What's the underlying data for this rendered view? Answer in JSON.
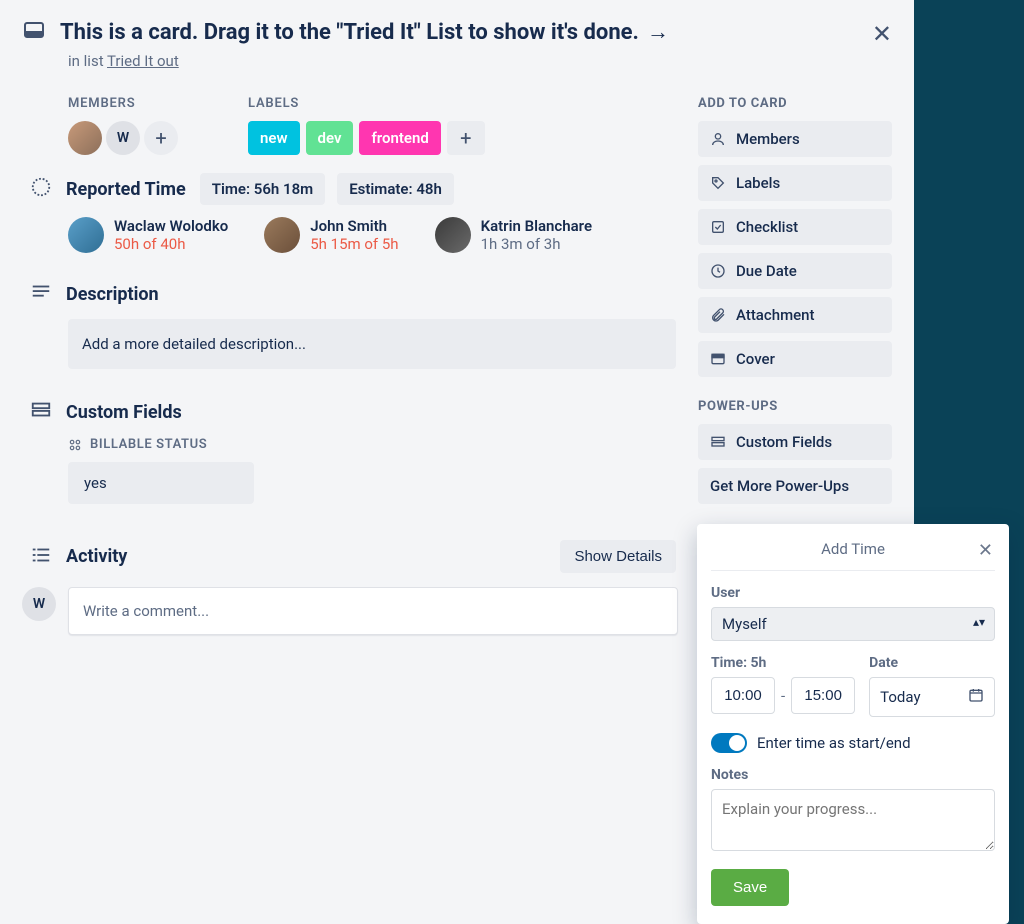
{
  "header": {
    "title": "This is a card. Drag it to the \"Tried It\" List to show it's done.",
    "in_list_prefix": "in list ",
    "in_list_link": "Tried It out"
  },
  "members": {
    "label": "MEMBERS",
    "initial": "W"
  },
  "labels": {
    "label": "LABELS",
    "items": [
      "new",
      "dev",
      "frontend"
    ]
  },
  "reported_time": {
    "title": "Reported Time",
    "time_chip": "Time: 56h 18m",
    "estimate_chip": "Estimate: 48h",
    "reporters": [
      {
        "name": "Waclaw Wolodko",
        "time": "50h of 40h",
        "over": true
      },
      {
        "name": "John Smith",
        "time": "5h 15m of 5h",
        "over": true
      },
      {
        "name": "Katrin Blanchare",
        "time": "1h 3m of 3h",
        "over": false
      }
    ]
  },
  "description": {
    "title": "Description",
    "placeholder": "Add a more detailed description..."
  },
  "custom_fields": {
    "title": "Custom Fields",
    "field_label": "BILLABLE STATUS",
    "field_value": "yes"
  },
  "activity": {
    "title": "Activity",
    "show_details": "Show Details",
    "commenter_initial": "W",
    "comment_placeholder": "Write a comment..."
  },
  "sidebar": {
    "add_to_card_heading": "ADD TO CARD",
    "add_items": [
      "Members",
      "Labels",
      "Checklist",
      "Due Date",
      "Attachment",
      "Cover"
    ],
    "powerups_heading": "POWER-UPS",
    "powerup_items": [
      "Custom Fields",
      "Get More Power-Ups"
    ]
  },
  "popover": {
    "title": "Add Time",
    "user_label": "User",
    "user_value": "Myself",
    "time_label": "Time: 5h",
    "date_label": "Date",
    "time_from": "10:00",
    "time_to": "15:00",
    "date_value": "Today",
    "toggle_label": "Enter time as start/end",
    "notes_label": "Notes",
    "notes_placeholder": "Explain your progress...",
    "save": "Save"
  }
}
